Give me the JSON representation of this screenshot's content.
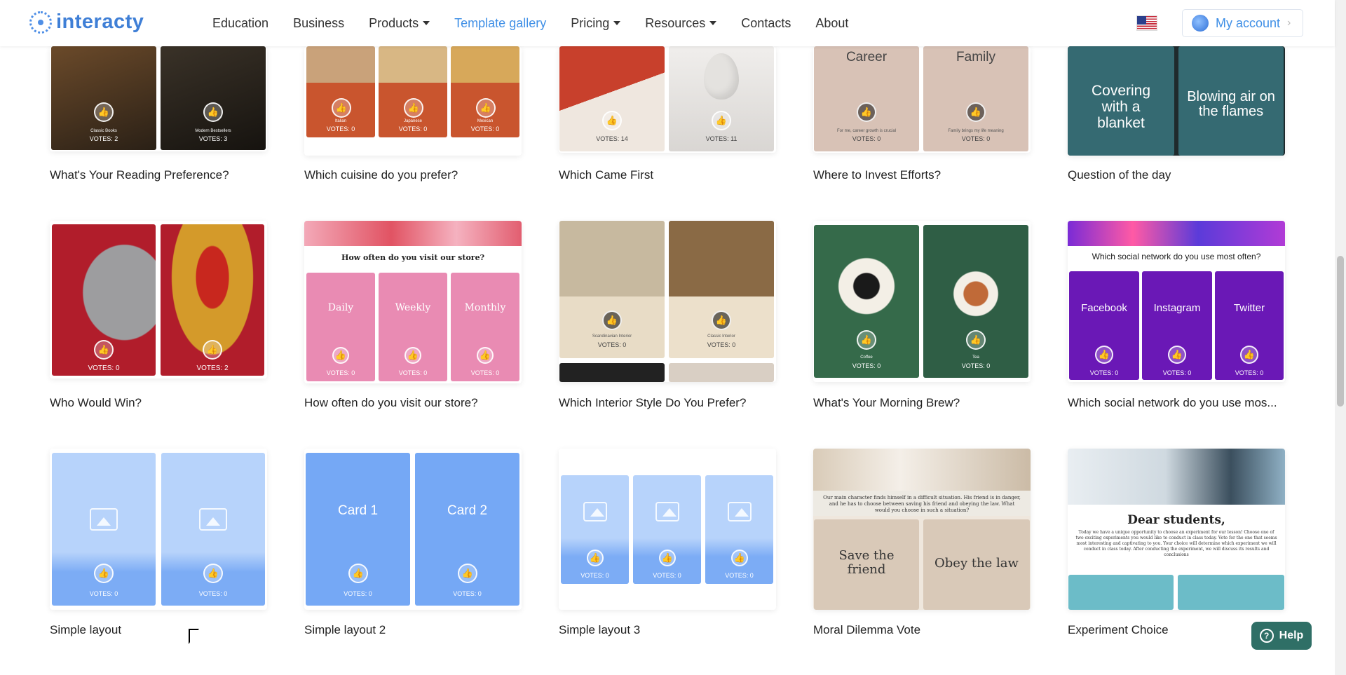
{
  "header": {
    "brand": "interacty",
    "nav": [
      {
        "label": "Education",
        "dropdown": false,
        "active": false
      },
      {
        "label": "Business",
        "dropdown": false,
        "active": false
      },
      {
        "label": "Products",
        "dropdown": true,
        "active": false
      },
      {
        "label": "Template gallery",
        "dropdown": false,
        "active": true
      },
      {
        "label": "Pricing",
        "dropdown": true,
        "active": false
      },
      {
        "label": "Resources",
        "dropdown": true,
        "active": false
      },
      {
        "label": "Contacts",
        "dropdown": false,
        "active": false
      },
      {
        "label": "About",
        "dropdown": false,
        "active": false
      }
    ],
    "account_label": "My account",
    "account_chevron": "›"
  },
  "colors": {
    "accent": "#3f8fe6",
    "help": "#2f6f66"
  },
  "cards": [
    {
      "title": "What's Your Reading Preference?",
      "tiles": [
        {
          "label": "Classic Books",
          "votes": "VOTES: 2"
        },
        {
          "label": "Modern Bestsellers",
          "votes": "VOTES: 3"
        }
      ]
    },
    {
      "title": "Which cuisine do you prefer?",
      "tiles": [
        {
          "label": "Italian",
          "votes": "VOTES: 0"
        },
        {
          "label": "Japanese",
          "votes": "VOTES: 0"
        },
        {
          "label": "Mexican",
          "votes": "VOTES: 0"
        }
      ]
    },
    {
      "title": "Which Came First",
      "tiles": [
        {
          "label": "",
          "votes": "VOTES: 14"
        },
        {
          "label": "",
          "votes": "VOTES: 11"
        }
      ]
    },
    {
      "title": "Where to Invest Efforts?",
      "tiles": [
        {
          "label": "Career",
          "caption": "For me, career growth is crucial",
          "votes": "VOTES: 0"
        },
        {
          "label": "Family",
          "caption": "Family brings my life meaning",
          "votes": "VOTES: 0"
        }
      ]
    },
    {
      "title": "Question of the day",
      "tiles": [
        {
          "label": "Covering with a blanket"
        },
        {
          "label": "Blowing air on the flames"
        }
      ]
    },
    {
      "title": "Who Would Win?",
      "tiles": [
        {
          "label": "",
          "votes": "VOTES: 0"
        },
        {
          "label": "",
          "votes": "VOTES: 2"
        }
      ]
    },
    {
      "title": "How often do you visit our store?",
      "question": "How often do you visit our store?",
      "tiles": [
        {
          "label": "Daily",
          "votes": "VOTES: 0"
        },
        {
          "label": "Weekly",
          "votes": "VOTES: 0"
        },
        {
          "label": "Monthly",
          "votes": "VOTES: 0"
        }
      ]
    },
    {
      "title": "Which Interior Style Do You Prefer?",
      "tiles": [
        {
          "label": "Scandinavian Interior",
          "votes": "VOTES: 0"
        },
        {
          "label": "Classic Interior",
          "votes": "VOTES: 0"
        }
      ]
    },
    {
      "title": "What's Your Morning Brew?",
      "tiles": [
        {
          "label": "Coffee",
          "votes": "VOTES: 0"
        },
        {
          "label": "Tea",
          "votes": "VOTES: 0"
        }
      ]
    },
    {
      "title": "Which social network do you use mos...",
      "question": "Which social network do you use most often?",
      "tiles": [
        {
          "label": "Facebook",
          "votes": "VOTES: 0"
        },
        {
          "label": "Instagram",
          "votes": "VOTES: 0"
        },
        {
          "label": "Twitter",
          "votes": "VOTES: 0"
        }
      ]
    },
    {
      "title": "Simple layout",
      "tiles": [
        {
          "label": "",
          "votes": "VOTES: 0"
        },
        {
          "label": "",
          "votes": "VOTES: 0"
        }
      ]
    },
    {
      "title": "Simple layout 2",
      "tiles": [
        {
          "label": "Card 1",
          "votes": "VOTES: 0"
        },
        {
          "label": "Card 2",
          "votes": "VOTES: 0"
        }
      ]
    },
    {
      "title": "Simple layout 3",
      "tiles": [
        {
          "label": "",
          "votes": "VOTES: 0"
        },
        {
          "label": "",
          "votes": "VOTES: 0"
        },
        {
          "label": "",
          "votes": "VOTES: 0"
        }
      ]
    },
    {
      "title": "Moral Dilemma Vote",
      "question": "Our main character finds himself in a difficult situation. His friend is in danger, and he has to choose between saving his friend and obeying the law. What would you choose in such a situation?",
      "tiles": [
        {
          "label": "Save the friend"
        },
        {
          "label": "Obey the law"
        }
      ]
    },
    {
      "title": "Experiment Choice",
      "heading": "Dear students,",
      "body": "Today we have a unique opportunity to choose an experiment for our lesson! Choose one of two exciting experiments you would like to conduct in class today. Vote for the one that seems most interesting and captivating to you. Your choice will determine which experiment we will conduct in class today. After conducting the experiment, we will discuss its results and conclusions"
    }
  ],
  "help_label": "Help",
  "help_icon": "?"
}
